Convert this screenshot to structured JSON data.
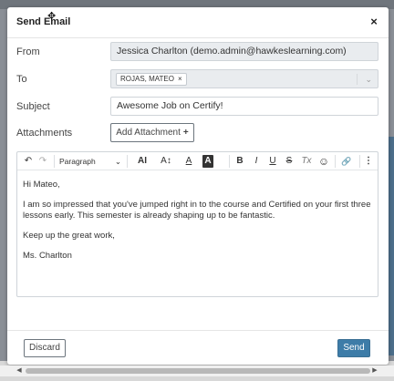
{
  "dialog": {
    "title": "Send Email",
    "close_label": "×",
    "move_cursor_glyph": "✥"
  },
  "form": {
    "from_label": "From",
    "from_value": "Jessica Charlton (demo.admin@hawkeslearning.com)",
    "to_label": "To",
    "to_recipients": [
      {
        "name": "ROJAS, MATEO",
        "remove_label": "×"
      }
    ],
    "to_dropdown_glyph": "⌄",
    "subject_label": "Subject",
    "subject_value": "Awesome Job on Certify!",
    "attachments_label": "Attachments",
    "add_attachment_label": "Add Attachment",
    "add_attachment_plus": "+"
  },
  "editor": {
    "toolbar": {
      "undo_icon": "↶",
      "redo_icon": "↷",
      "paragraph_label": "Paragraph",
      "font_size_icon": "AI",
      "line_height_icon": "A↕",
      "font_color_icon": "A",
      "highlight_icon": "A",
      "bold_icon": "B",
      "italic_icon": "I",
      "underline_icon": "U",
      "strike_icon": "S",
      "clear_format_icon": "Tx",
      "emoji_icon": "☺",
      "link_icon": "🔗",
      "more_icon": "⋮",
      "dropdown_glyph": "⌄"
    },
    "body": {
      "greeting": "Hi Mateo,",
      "paragraph1": "I am so impressed that you've jumped right in to the course and Certified on your first three lessons early. This semester is already shaping up to be fantastic.",
      "closing": "Keep up the great work,",
      "signature": "Ms. Charlton"
    }
  },
  "footer": {
    "discard_label": "Discard",
    "send_label": "Send"
  },
  "scrollbar": {
    "left_arrow": "◀",
    "right_arrow": "▶"
  },
  "colors": {
    "send_button": "#3d7ca8",
    "readonly_field": "#e9ecef",
    "overlay": "#8a8f96"
  }
}
